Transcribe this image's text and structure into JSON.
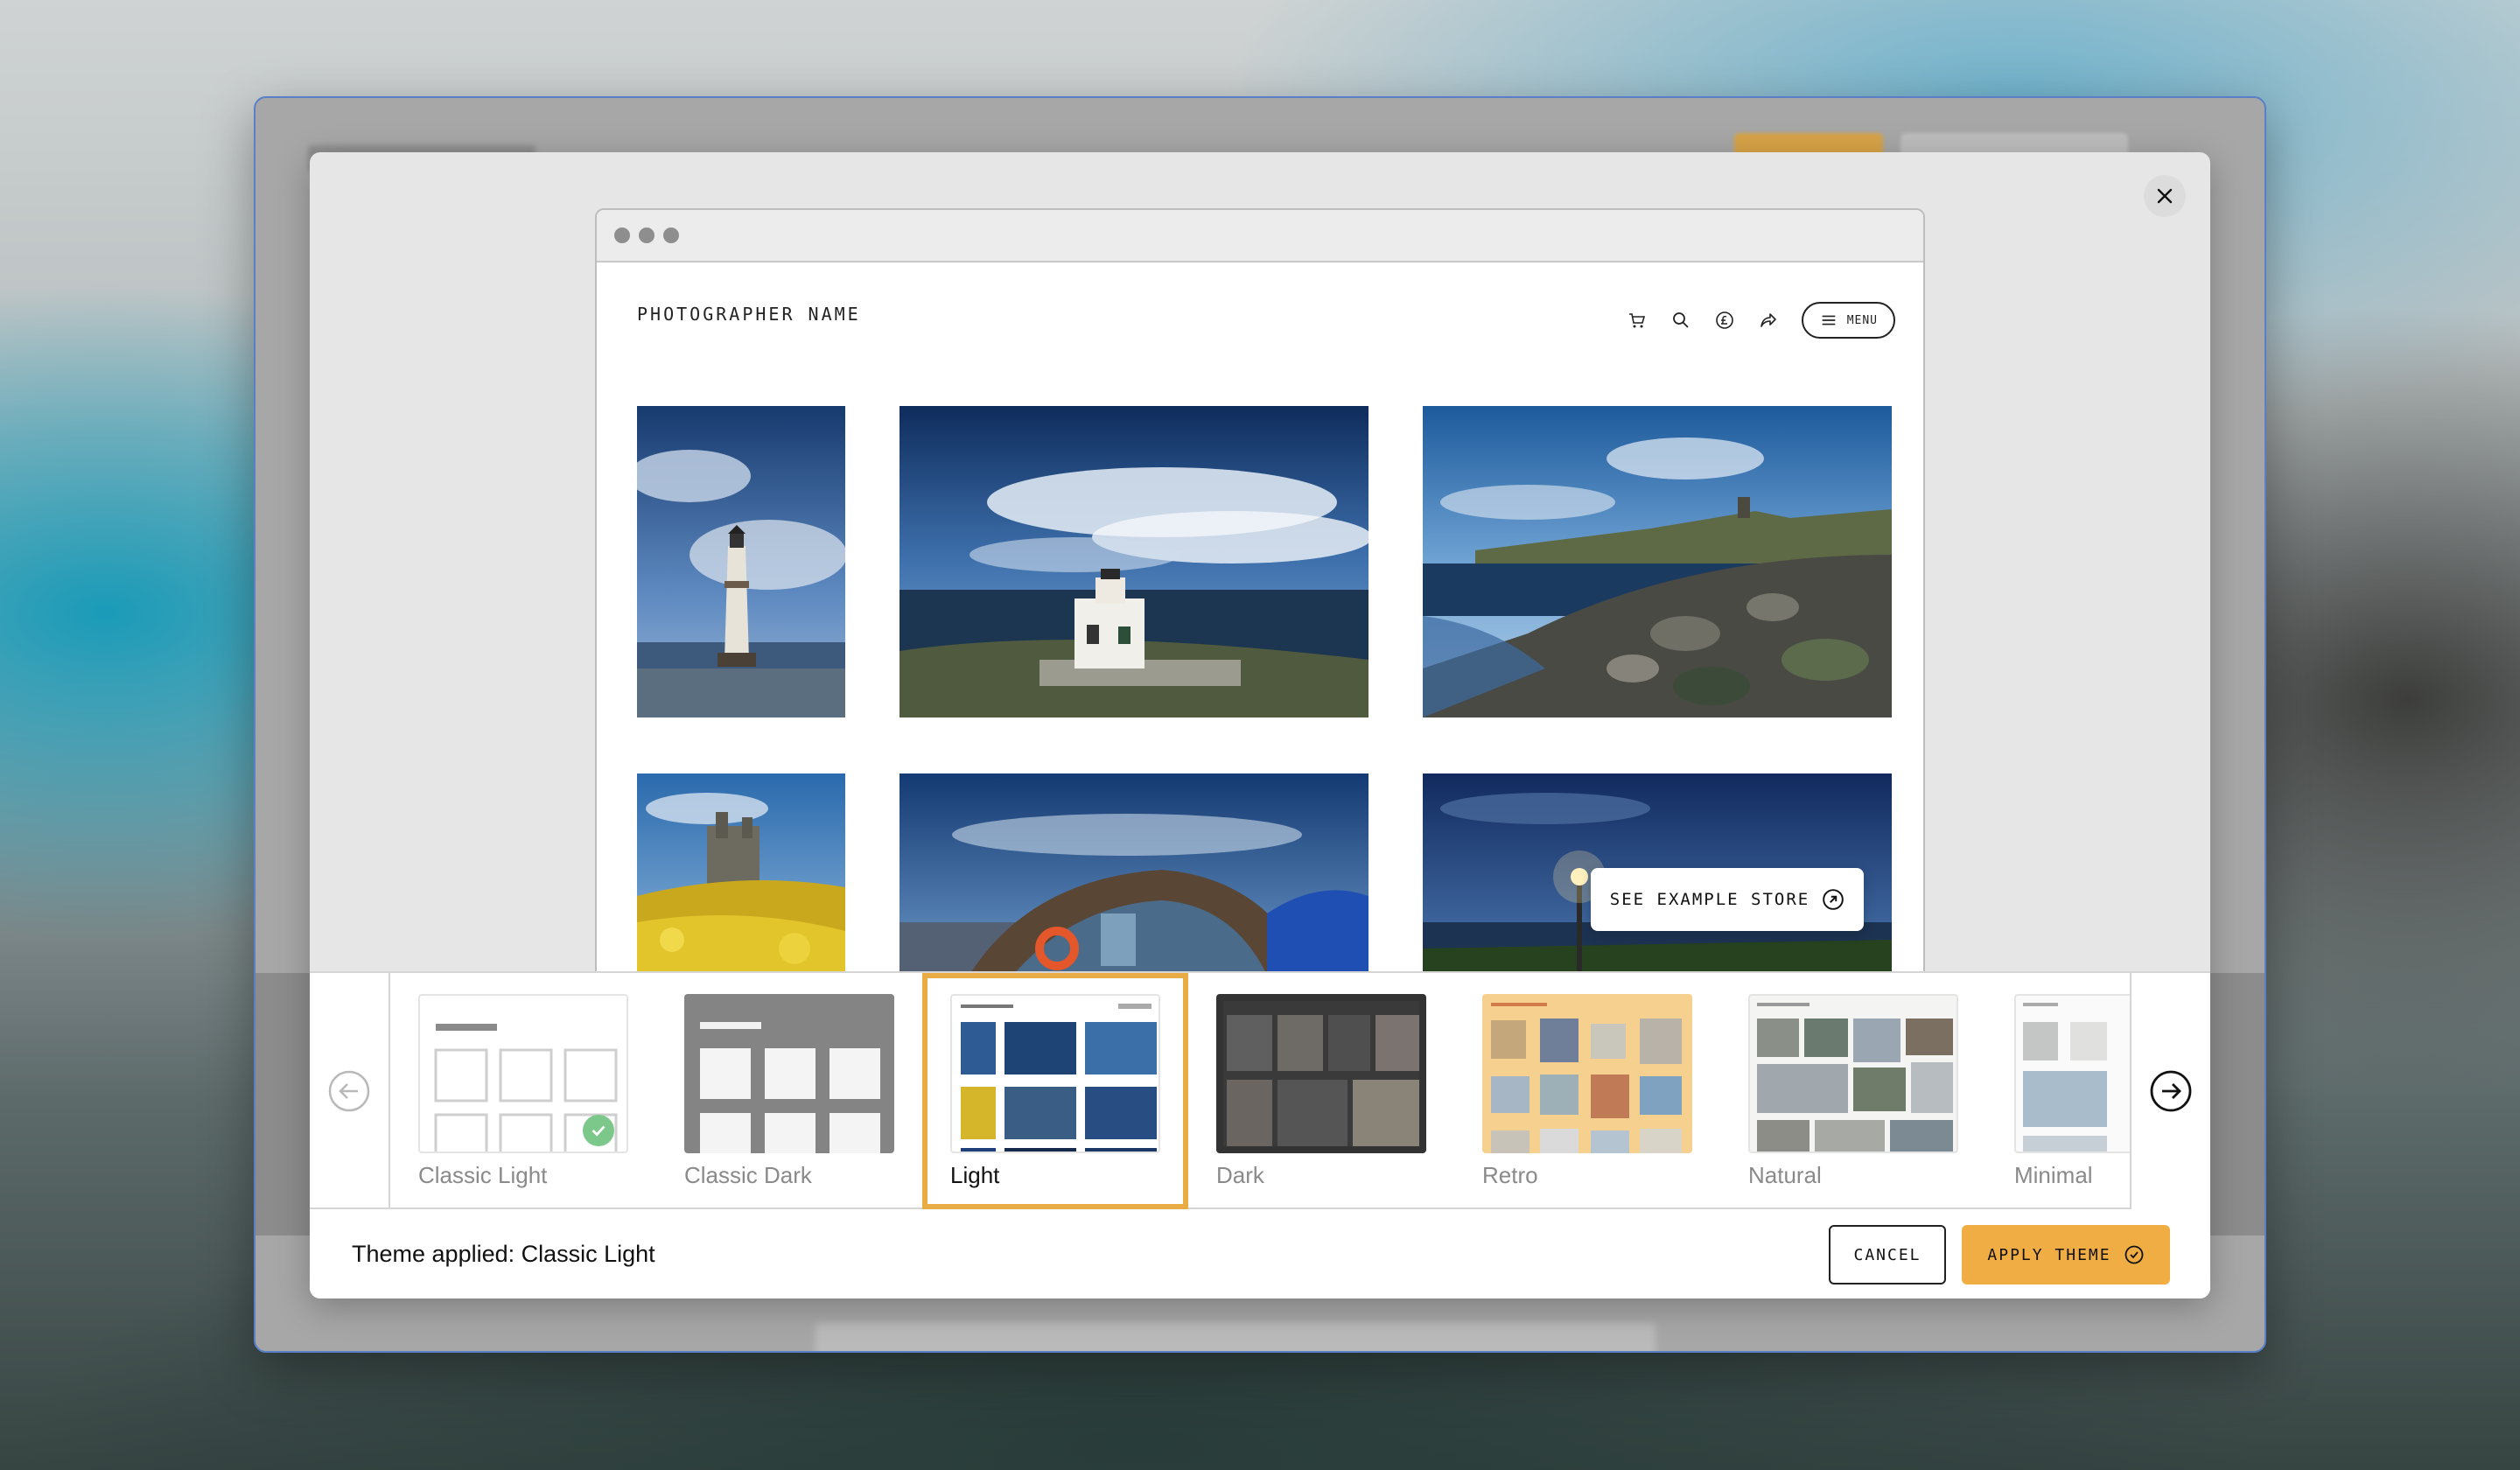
{
  "preview": {
    "site_title": "PHOTOGRAPHER NAME",
    "menu_label": "MENU",
    "see_store_label": "SEE EXAMPLE STORE"
  },
  "themes": [
    {
      "label": "Classic Light",
      "applied": true
    },
    {
      "label": "Classic Dark"
    },
    {
      "label": "Light",
      "selected": true
    },
    {
      "label": "Dark"
    },
    {
      "label": "Retro"
    },
    {
      "label": "Natural"
    },
    {
      "label": "Minimal"
    }
  ],
  "footer": {
    "status_text": "Theme applied: Classic Light",
    "cancel_label": "CANCEL",
    "apply_label": "APPLY THEME"
  },
  "colors": {
    "accent": "#f0ad44",
    "applied_check": "#7cc88a"
  }
}
